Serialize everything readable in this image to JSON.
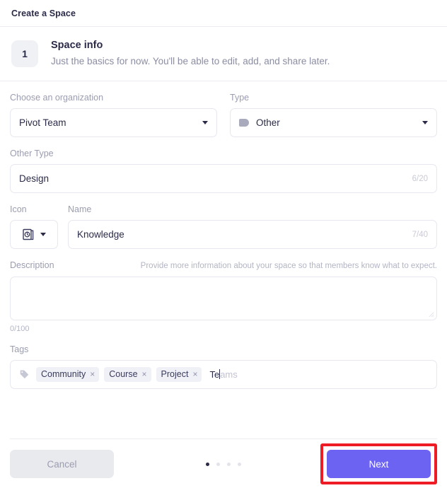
{
  "window": {
    "title": "Create a Space"
  },
  "step": {
    "number": "1",
    "title": "Space info",
    "subtitle": "Just the basics for now. You'll be able to edit, add, and share later."
  },
  "organization": {
    "label": "Choose an organization",
    "value": "Pivot Team"
  },
  "type": {
    "label": "Type",
    "value": "Other"
  },
  "other_type": {
    "label": "Other Type",
    "value": "Design",
    "counter": "6/20"
  },
  "icon": {
    "label": "Icon",
    "glyph_name": "book-clock-icon"
  },
  "name": {
    "label": "Name",
    "value": "Knowledge",
    "counter": "7/40"
  },
  "description": {
    "label": "Description",
    "hint": "Provide more information about your space so that members know what to expect.",
    "value": "",
    "counter": "0/100"
  },
  "tags": {
    "label": "Tags",
    "chips": [
      {
        "label": "Community",
        "remove": "×"
      },
      {
        "label": "Course",
        "remove": "×"
      },
      {
        "label": "Project",
        "remove": "×"
      }
    ],
    "typed_text": "Te",
    "suggestion_text": "ams"
  },
  "footer": {
    "cancel_label": "Cancel",
    "next_label": "Next",
    "pagination_total": 4,
    "pagination_active": 1
  },
  "colors": {
    "accent": "#6c63f2",
    "highlight": "#ee1c24",
    "text_dark": "#2b2b49",
    "text_muted": "#9b9db0",
    "border": "#e7e8ef",
    "chip_bg": "#f0f1f7"
  }
}
